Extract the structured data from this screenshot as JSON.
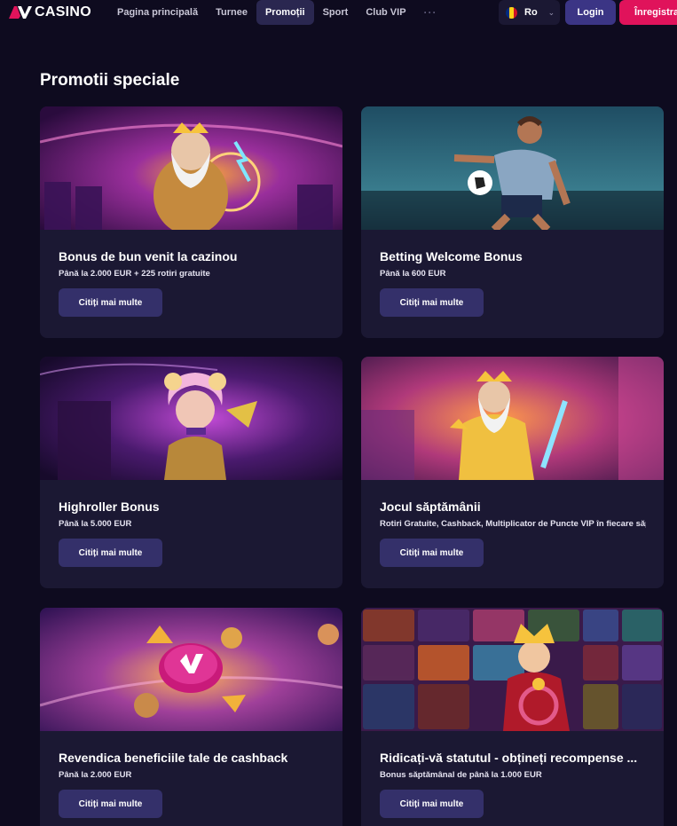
{
  "header": {
    "logo_text": "CASINO",
    "nav": [
      "Pagina principală",
      "Turnee",
      "Promoții",
      "Sport",
      "Club VIP"
    ],
    "nav_more": "···",
    "active_nav": "Promoții",
    "language": "Ro",
    "login": "Login",
    "register": "Înregistrar"
  },
  "page": {
    "title": "Promotii speciale"
  },
  "cards": [
    {
      "title": "Bonus de bun venit la cazinou",
      "subtitle": "Până la 2.000 EUR + 225 rotiri gratuite",
      "button": "Citiți mai multe",
      "image": "zeus-lightning-art"
    },
    {
      "title": "Betting Welcome Bonus",
      "subtitle": "Până la 600 EUR",
      "button": "Citiți mai multe",
      "image": "football-player-art"
    },
    {
      "title": "Highroller Bonus",
      "subtitle": "Până la 5.000 EUR",
      "button": "Citiți mai multe",
      "image": "jester-girl-art"
    },
    {
      "title": "Jocul săptămânii",
      "subtitle": "Rotiri Gratuite, Cashback, Multiplicator de Puncte VIP în fiecare săp",
      "button": "Citiți mai multe",
      "image": "zeus-sword-art"
    },
    {
      "title": "Revendica beneficiile tale de cashback",
      "subtitle": "Până la 2.000 EUR",
      "button": "Citiți mai multe",
      "image": "casino-chip-coins-art"
    },
    {
      "title": "Ridicați-vă statutul - obțineți recompense ...",
      "subtitle": "Bonus săptămânal de până la 1.000 EUR",
      "button": "Citiți mai multe",
      "image": "king-slot-tiles-art"
    }
  ],
  "colors": {
    "background": "#0e0b1f",
    "card": "#1b1833",
    "button": "#34306a",
    "login": "#3b3585",
    "register": "#e0135b"
  }
}
